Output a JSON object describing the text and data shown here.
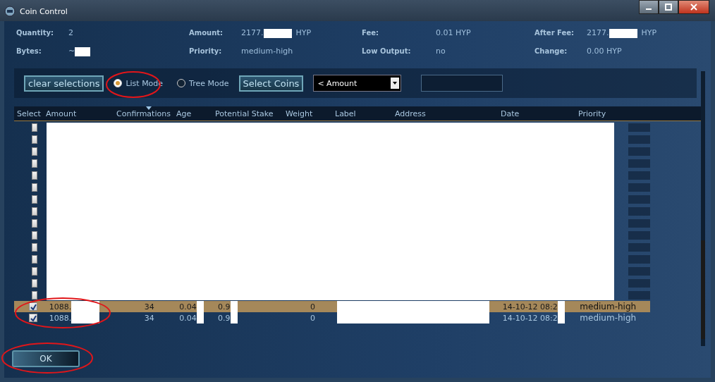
{
  "window": {
    "title": "Coin Control"
  },
  "summary": [
    {
      "label": "Quantity:",
      "value": "2"
    },
    {
      "label": "Amount:",
      "value": "2177.",
      "redacted": true,
      "suffix": "HYP"
    },
    {
      "label": "Fee:",
      "value": "0.01 HYP"
    },
    {
      "label": "After Fee:",
      "value": "2177.",
      "redacted": true,
      "suffix": "HYP"
    },
    {
      "label": "Bytes:",
      "value": "~",
      "redacted": true
    },
    {
      "label": "Priority:",
      "value": "medium-high"
    },
    {
      "label": "Low Output:",
      "value": "no"
    },
    {
      "label": "Change:",
      "value": "0.00 HYP"
    }
  ],
  "toolbar": {
    "clear_button": "clear selections",
    "modes": [
      {
        "label": "List Mode",
        "selected": true
      },
      {
        "label": "Tree Mode",
        "selected": false
      }
    ],
    "select_button": "Select Coins",
    "dropdown": "< Amount"
  },
  "table": {
    "columns": [
      "Select",
      "Amount",
      "Confirmations",
      "Age",
      "Potential Stake",
      "Weight",
      "Label",
      "Address",
      "Date",
      "Priority"
    ],
    "rows": [
      {
        "checked": false
      },
      {
        "checked": false
      },
      {
        "checked": false
      },
      {
        "checked": false
      },
      {
        "checked": false
      },
      {
        "checked": false
      },
      {
        "checked": false
      },
      {
        "checked": false
      },
      {
        "checked": false
      },
      {
        "checked": false
      },
      {
        "checked": false
      },
      {
        "checked": false
      },
      {
        "checked": false
      },
      {
        "checked": false
      },
      {
        "checked": false
      },
      {
        "checked": true,
        "selected": true,
        "amount": "1088.",
        "confirmations": "34",
        "age": "0.04",
        "stake": "0.9",
        "weight": "0",
        "date": "14-10-12 08:2",
        "priority": "medium-high"
      },
      {
        "checked": true,
        "selected": false,
        "amount": "1088.",
        "confirmations": "34",
        "age": "0.04",
        "stake": "0.9",
        "weight": "0",
        "date": "14-10-12 08:2",
        "priority": "medium-high"
      }
    ]
  },
  "ok_button": "OK"
}
